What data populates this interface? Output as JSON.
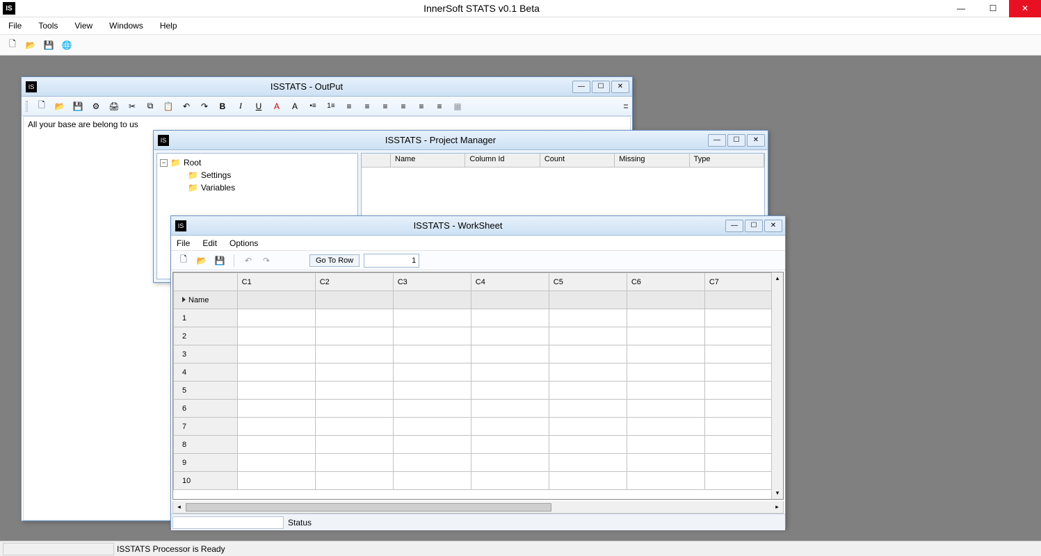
{
  "app": {
    "title": "InnerSoft STATS v0.1 Beta",
    "icon_text": "IS",
    "statusbar": "ISSTATS Processor is Ready"
  },
  "menubar": [
    "File",
    "Tools",
    "View",
    "Windows",
    "Help"
  ],
  "child_windows": {
    "output": {
      "title": "ISSTATS - OutPut",
      "body_text": "All your base are belong to us",
      "toolbar": {
        "bold": "B",
        "italic": "I",
        "underline": "U",
        "font_fg": "A",
        "font_sz": "A"
      }
    },
    "project_manager": {
      "title": "ISSTATS - Project Manager",
      "tree": {
        "root": "Root",
        "settings": "Settings",
        "variables": "Variables"
      },
      "columns": [
        "Name",
        "Column Id",
        "Count",
        "Missing",
        "Type"
      ]
    },
    "worksheet": {
      "title": "ISSTATS - WorkSheet",
      "menubar": [
        "File",
        "Edit",
        "Options"
      ],
      "toolbar": {
        "goto_label": "Go To Row",
        "goto_value": "1"
      },
      "columns": [
        "C1",
        "C2",
        "C3",
        "C4",
        "C5",
        "C6",
        "C7"
      ],
      "name_row_label": "Name",
      "row_numbers": [
        "1",
        "2",
        "3",
        "4",
        "5",
        "6",
        "7",
        "8",
        "9",
        "10"
      ],
      "status_label": "Status"
    }
  }
}
